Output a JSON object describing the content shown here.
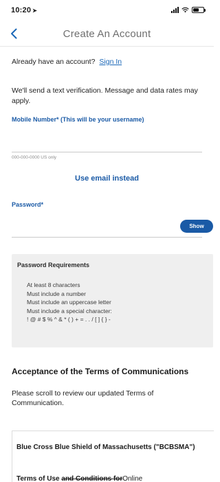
{
  "status_bar": {
    "time": "10:20",
    "location_arrow": "➤",
    "battery_level": 0.55
  },
  "header": {
    "title": "Create An Account",
    "back_icon": "chevron-left-icon"
  },
  "signin": {
    "prompt": "Already have an account?",
    "link": "Sign In"
  },
  "verify_text": "We'll send a text verification. Message and data rates may apply.",
  "mobile": {
    "label": "Mobile Number* (This will be your username)",
    "value": "",
    "hint": "000-000-0000 US only"
  },
  "email_link": "Use email instead",
  "password": {
    "label": "Password*",
    "value": "",
    "show_label": "Show"
  },
  "password_requirements": {
    "title": "Password Requirements",
    "items": [
      "At least 8 characters",
      "Must include a number",
      "Must include an uppercase letter",
      "Must include a special character:",
      "! @ # $ % ^ & * ( ) + = . . / [ ] { } -"
    ]
  },
  "terms": {
    "heading": "Acceptance of the Terms of Communications",
    "text": "Please scroll to review our updated Terms of Communication.",
    "org": "Blue Cross Blue Shield of Massachusetts (\"BCBSMA\")",
    "sub_prefix": "Terms of Use ",
    "sub_strike": "and Conditions for",
    "sub_tail": "Online"
  },
  "colors": {
    "accent": "#1a5aa6",
    "link": "#1a67b7",
    "requirements_bg": "#efefef"
  }
}
